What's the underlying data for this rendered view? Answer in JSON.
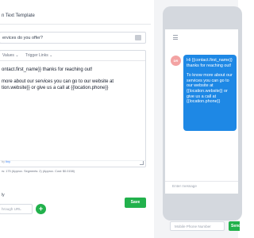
{
  "template": {
    "title": "n Text Template",
    "question_value": "ervices do you offer?",
    "toolbar": {
      "values_label": "Values",
      "trigger_links_label": "Trigger Links"
    },
    "body": {
      "line1": "ontact.first_name}} thanks for reaching out!",
      "line2": "more about our services you can go to our website at",
      "line3": "tion.website}} or give us a call at {{location.phone}}"
    },
    "powered_by": {
      "prefix": "by ",
      "brand": "tiny"
    },
    "stats": "rs: 175 (Approx. Segments: 2) (Approx. Cost: $0.0158)",
    "save_label": "Save",
    "attach": {
      "label": "ly",
      "placeholder": "hrough URL",
      "add_symbol": "+"
    }
  },
  "preview": {
    "avatar_initials": "DR",
    "message_part1": "Hi {{contact.first_name}} thanks for reaching out!",
    "message_part2": "To know more about our services you can go to our website at {{location.website}} or give us a call at {{location.phone}}",
    "input_placeholder": "Enter message",
    "phone_number_placeholder": "Mobile Phone Number",
    "send_label": "Send"
  },
  "colors": {
    "accent_green": "#22b14c",
    "bubble_blue": "#1e88e5",
    "avatar_pink": "#f3a3a3"
  }
}
